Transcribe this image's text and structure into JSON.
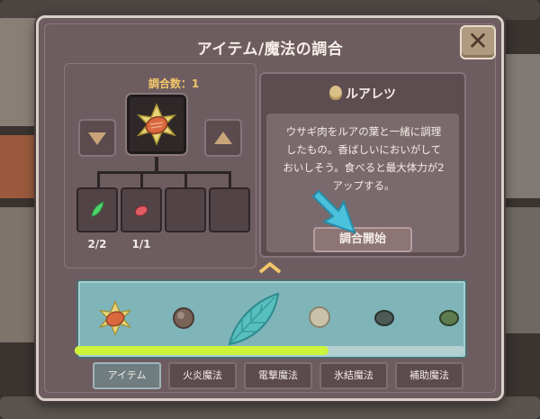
{
  "dialog": {
    "title": "アイテム/魔法の調合",
    "close_label": "✕"
  },
  "craft": {
    "count_label": "調合数：1",
    "ingredients": [
      {
        "count": "2/2",
        "icon": "green-leaf-icon"
      },
      {
        "count": "1/1",
        "icon": "red-meat-icon"
      }
    ]
  },
  "item": {
    "name": "ルアレツ",
    "description": "ウサギ肉をルアの葉と一緒に調理\nしたもの。香ばしいにおいがして\nおいしそう。食べると最大体力が2\nアップする。",
    "start_label": "調合開始"
  },
  "inventory": {
    "items": [
      "ruaretsu-dish-icon",
      "brown-nut-icon",
      "teal-leaf-icon",
      "pale-stone-icon",
      "dark-ore-icon",
      "green-ore-icon"
    ],
    "scroll_fraction": 0.65
  },
  "tabs": [
    {
      "label": "アイテム",
      "active": true
    },
    {
      "label": "火炎魔法",
      "active": false
    },
    {
      "label": "電撃魔法",
      "active": false
    },
    {
      "label": "氷結魔法",
      "active": false
    },
    {
      "label": "補助魔法",
      "active": false
    }
  ],
  "colors": {
    "accent_gold": "#f2c76a",
    "inventory_bg": "#7fb4b9",
    "scroll_thumb": "#cdf43a",
    "pointer_arrow": "#48c9e6"
  }
}
